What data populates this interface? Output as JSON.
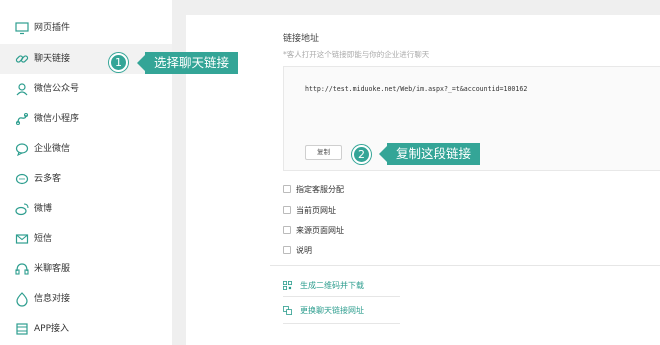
{
  "sidebar": {
    "items": [
      {
        "label": "网页插件",
        "icon": "monitor-icon"
      },
      {
        "label": "聊天链接",
        "icon": "link-icon"
      },
      {
        "label": "微信公众号",
        "icon": "wechat-official-icon"
      },
      {
        "label": "微信小程序",
        "icon": "mini-program-icon"
      },
      {
        "label": "企业微信",
        "icon": "wecom-icon"
      },
      {
        "label": "云多客",
        "icon": "chat-bubble-icon"
      },
      {
        "label": "微博",
        "icon": "weibo-icon"
      },
      {
        "label": "短信",
        "icon": "sms-icon"
      },
      {
        "label": "米聊客服",
        "icon": "service-icon"
      },
      {
        "label": "信息对接",
        "icon": "integration-icon"
      },
      {
        "label": "APP接入",
        "icon": "app-icon"
      }
    ],
    "active_index": 1
  },
  "main": {
    "section_title": "链接地址",
    "hint": "*客人打开这个链接即能与你的企业进行聊天",
    "link_url": "http://test.miduoke.net/Web/im.aspx?_=t&accountid=100162",
    "copy_label": "复制",
    "options": [
      {
        "label": "指定客服分配",
        "checked": false
      },
      {
        "label": "当前页网址",
        "checked": false
      },
      {
        "label": "来源页面网址",
        "checked": false
      },
      {
        "label": "说明",
        "checked": false
      }
    ],
    "actions": [
      {
        "label": "生成二维码并下载",
        "icon": "qrcode-icon"
      },
      {
        "label": "更换聊天链接网址",
        "icon": "swap-link-icon"
      }
    ]
  },
  "annotations": [
    {
      "number": "1",
      "text": "选择聊天链接"
    },
    {
      "number": "2",
      "text": "复制这段链接"
    }
  ],
  "colors": {
    "accent": "#34a597",
    "link_text": "#2e9e8f"
  }
}
